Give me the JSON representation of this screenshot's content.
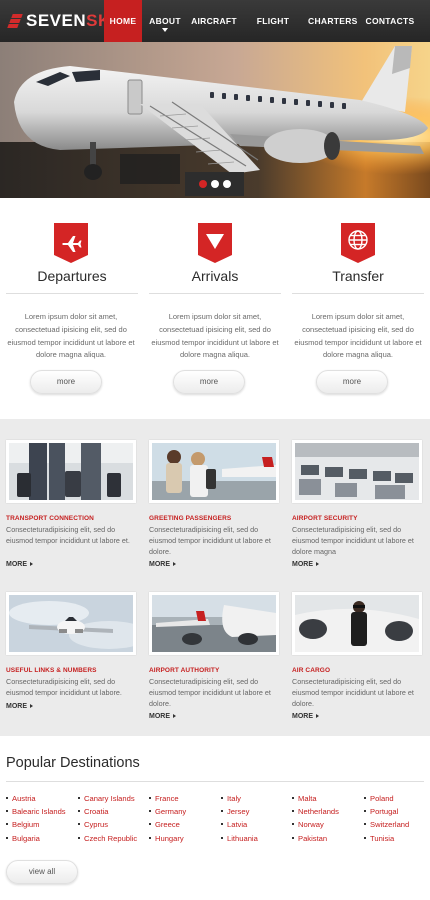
{
  "brand": {
    "part1": "SEVEN",
    "part2": "SKY",
    "accent": "#c62020"
  },
  "nav": {
    "items": [
      {
        "label": "HOME",
        "active": true
      },
      {
        "label": "ABOUT",
        "active": false,
        "has_submenu": true
      },
      {
        "label": "AIRCRAFT",
        "active": false
      },
      {
        "label": "FLIGHT INFO",
        "active": false
      },
      {
        "label": "CHARTERS",
        "active": false
      },
      {
        "label": "CONTACTS",
        "active": false
      }
    ]
  },
  "hero": {
    "image": "airplane-with-boarding-stairs-at-sunset",
    "slider": {
      "count": 3,
      "active_index": 0
    }
  },
  "features": [
    {
      "icon": "airplane-icon",
      "title": "Departures",
      "text": "Lorem ipsum dolor sit amet, consectetuad ipisicing elit, sed do eiusmod tempor incididunt ut labore et dolore magna aliqua.",
      "button": "more"
    },
    {
      "icon": "arrow-down-icon",
      "title": "Arrivals",
      "text": "Lorem ipsum dolor sit amet, consectetuad ipisicing elit, sed do eiusmod tempor incididunt ut labore et dolore magna aliqua.",
      "button": "more"
    },
    {
      "icon": "globe-icon",
      "title": "Transfer",
      "text": "Lorem ipsum dolor sit amet, consectetuad ipisicing elit, sed do eiusmod tempor incididunt ut labore et dolore magna aliqua.",
      "button": "more"
    }
  ],
  "cards": [
    {
      "image": "travelers-with-luggage",
      "title": "TRANSPORT CONNECTION",
      "text": "Consecteturadipisicing elit, sed do eiusmod tempor incididunt ut labore et.",
      "more": "MORE"
    },
    {
      "image": "couple-greeting-at-airport",
      "title": "GREETING PASSENGERS",
      "text": "Consecteturadipisicing elit, sed do eiusmod tempor incididunt ut labore et dolore.",
      "more": "MORE"
    },
    {
      "image": "airport-security-hall",
      "title": "AIRPORT SECURITY",
      "text": "Consecteturadipisicing elit, sed do eiusmod tempor incididunt ut labore et dolore magna",
      "more": "MORE"
    },
    {
      "image": "jet-in-flight",
      "title": "USEFUL LINKS & NUMBERS",
      "text": "Consecteturadipisicing elit, sed do eiusmod tempor incididunt ut labore.",
      "more": "MORE"
    },
    {
      "image": "airliners-on-tarmac",
      "title": "AIRPORT AUTHORITY",
      "text": "Consecteturadipisicing elit, sed do eiusmod tempor incididunt ut labore et dolore.",
      "more": "MORE"
    },
    {
      "image": "woman-by-private-jet",
      "title": "AIR CARGO",
      "text": "Consecteturadipisicing elit, sed do eiusmod tempor incididunt ut labore et dolore.",
      "more": "MORE"
    }
  ],
  "destinations": {
    "title": "Popular Destinations",
    "columns": [
      [
        "Austria",
        "Balearic Islands",
        "Belgium",
        "Bulgaria"
      ],
      [
        "Canary Islands",
        "Croatia",
        "Cyprus",
        "Czech Republic"
      ],
      [
        "France",
        "Germany",
        "Greece",
        "Hungary"
      ],
      [
        "Italy",
        "Jersey",
        "Latvia",
        "Lithuania"
      ],
      [
        "Malta",
        "Netherlands",
        "Norway",
        "Pakistan"
      ],
      [
        "Poland",
        "Portugal",
        "Switzerland",
        "Tunisia"
      ]
    ],
    "button": "view all"
  }
}
